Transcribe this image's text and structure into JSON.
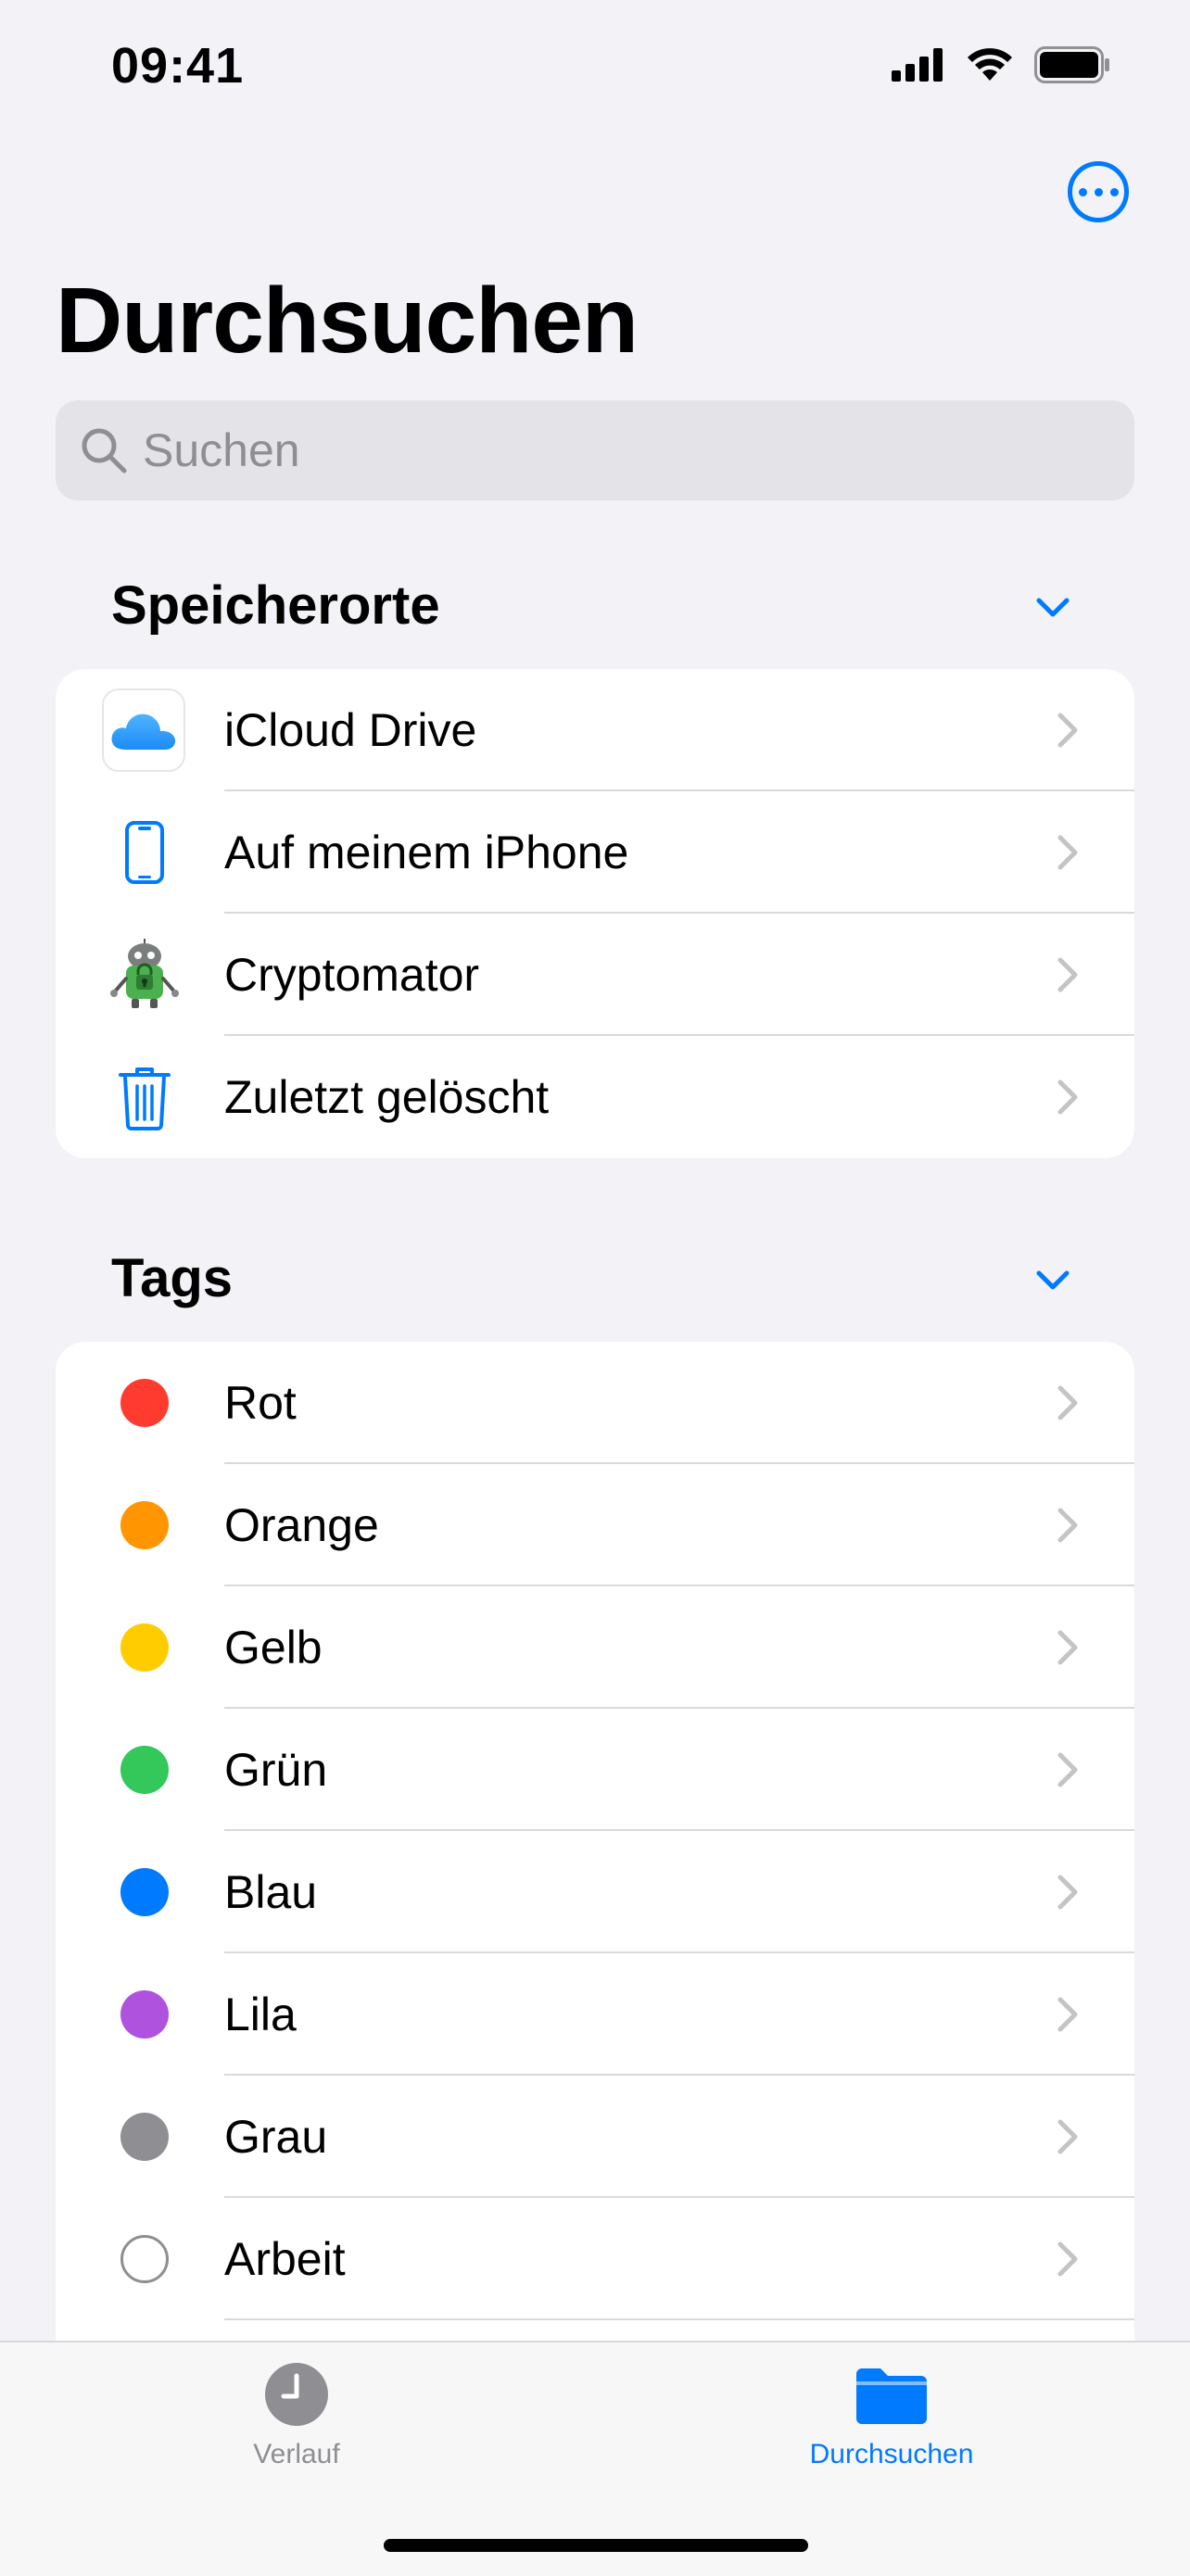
{
  "status_bar": {
    "time": "09:41"
  },
  "header": {
    "title": "Durchsuchen"
  },
  "search": {
    "placeholder": "Suchen"
  },
  "sections": {
    "locations": {
      "title": "Speicherorte",
      "items": [
        {
          "label": "iCloud Drive",
          "icon": "icloud-drive-icon"
        },
        {
          "label": "Auf meinem iPhone",
          "icon": "iphone-icon"
        },
        {
          "label": "Cryptomator",
          "icon": "cryptomator-robot-icon"
        },
        {
          "label": "Zuletzt gelöscht",
          "icon": "trash-icon"
        }
      ]
    },
    "tags": {
      "title": "Tags",
      "items": [
        {
          "label": "Rot",
          "color": "#FF3B30"
        },
        {
          "label": "Orange",
          "color": "#FF9500"
        },
        {
          "label": "Gelb",
          "color": "#FFCC00"
        },
        {
          "label": "Grün",
          "color": "#34C759"
        },
        {
          "label": "Blau",
          "color": "#007AFF"
        },
        {
          "label": "Lila",
          "color": "#AF52DE"
        },
        {
          "label": "Grau",
          "color": "#8E8E93"
        },
        {
          "label": "Arbeit",
          "color": "none"
        }
      ]
    }
  },
  "tab_bar": {
    "tabs": [
      {
        "label": "Verlauf",
        "icon": "clock-icon",
        "active": false
      },
      {
        "label": "Durchsuchen",
        "icon": "folder-icon",
        "active": true
      }
    ]
  },
  "colors": {
    "accent": "#007AFF",
    "inactive": "#8E8E93",
    "background": "#F2F2F7"
  }
}
